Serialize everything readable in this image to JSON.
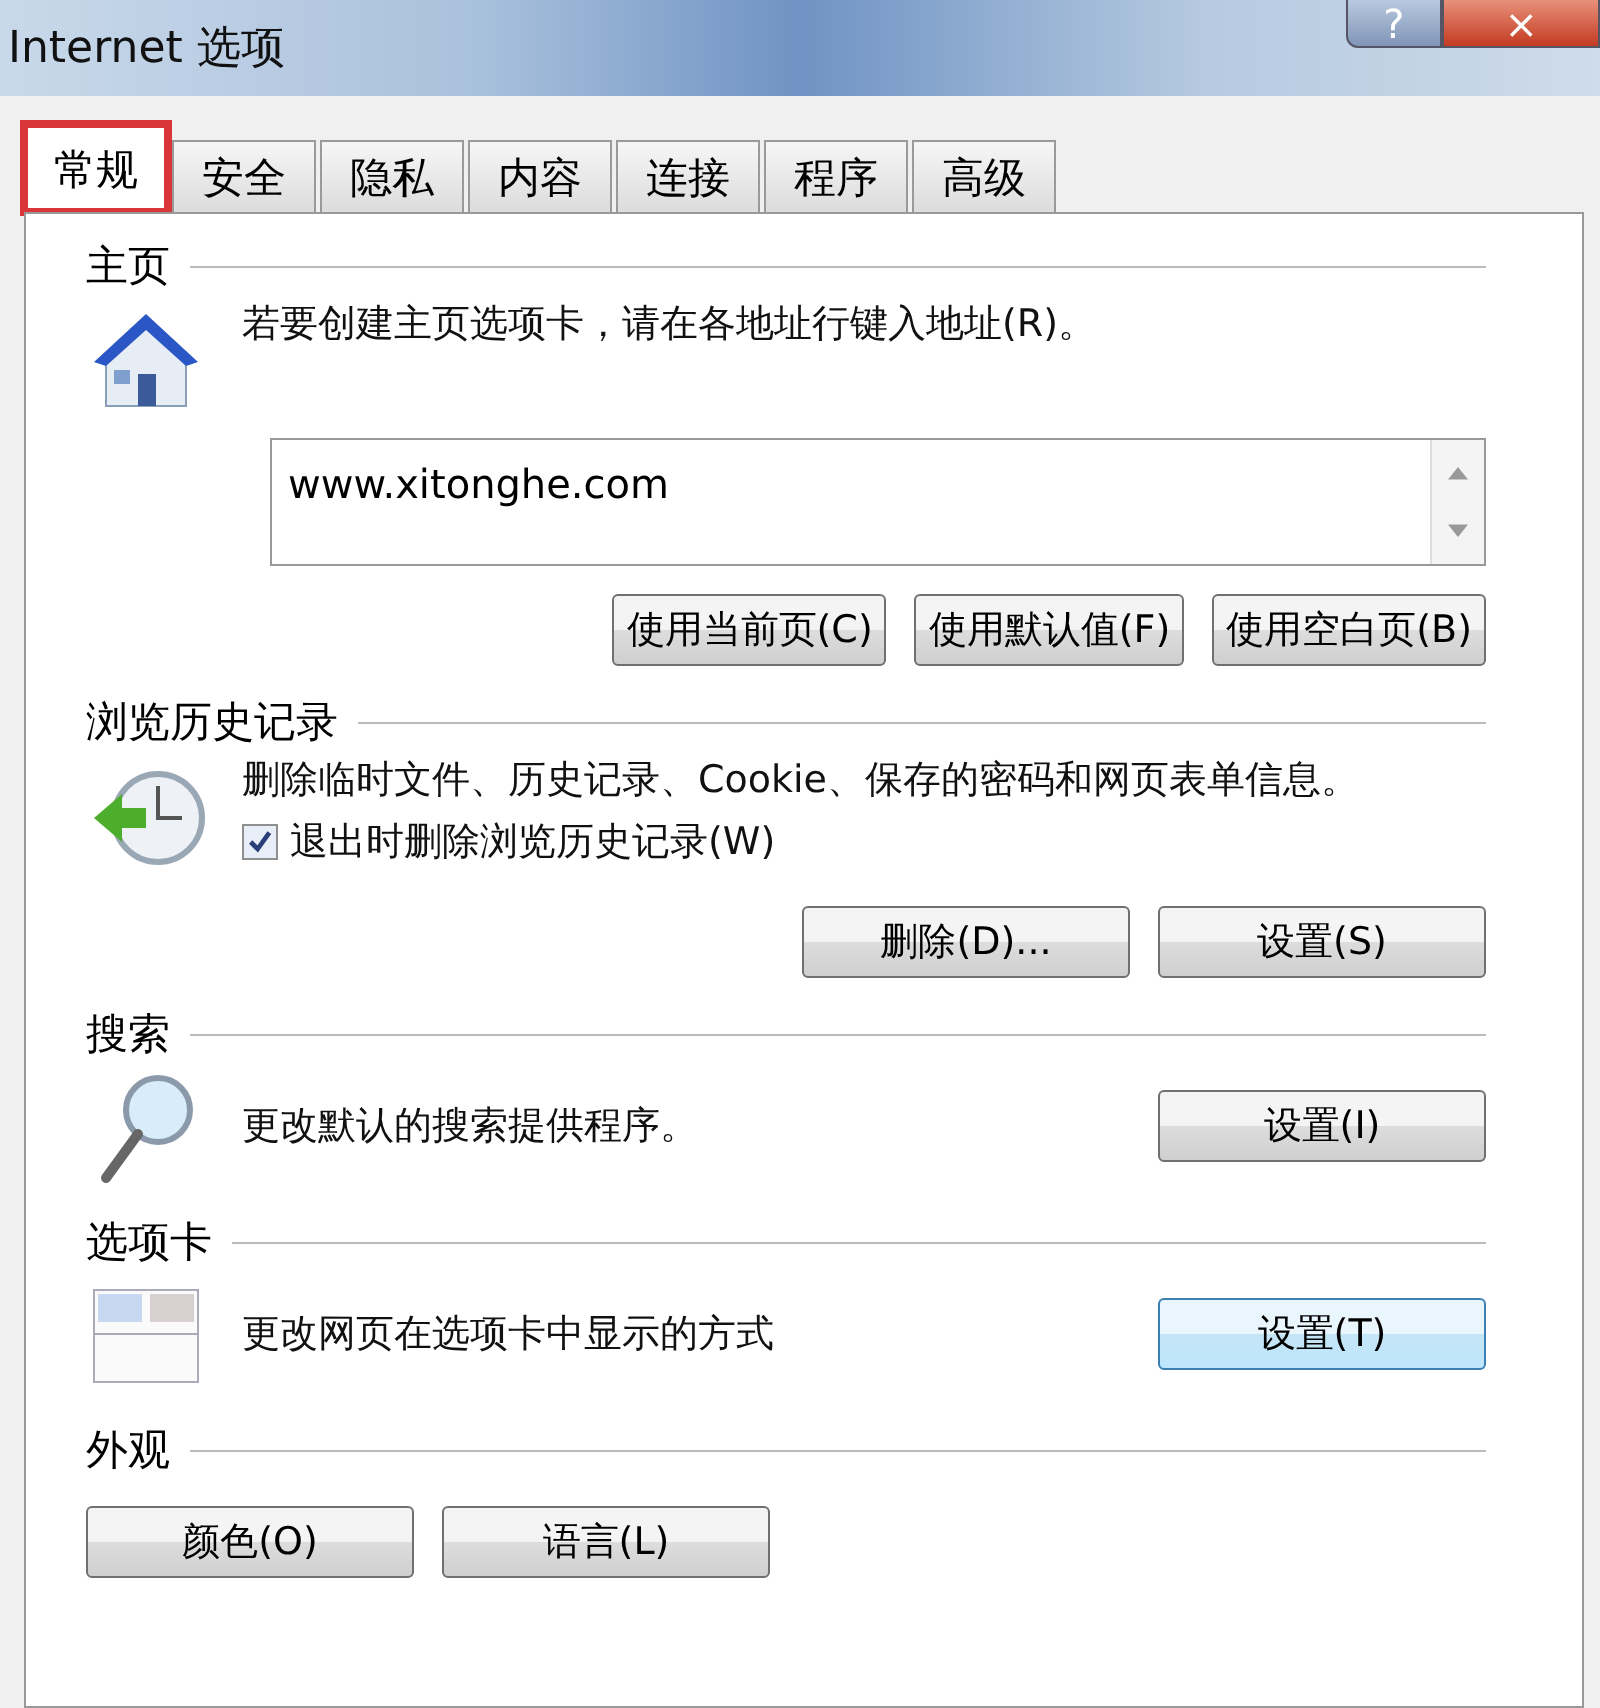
{
  "window": {
    "title": "Internet 选项",
    "help": "?",
    "close": "×"
  },
  "tabs": [
    {
      "label": "常规",
      "selected": true,
      "highlighted": true
    },
    {
      "label": "安全",
      "selected": false,
      "highlighted": false
    },
    {
      "label": "隐私",
      "selected": false,
      "highlighted": false
    },
    {
      "label": "内容",
      "selected": false,
      "highlighted": false
    },
    {
      "label": "连接",
      "selected": false,
      "highlighted": false
    },
    {
      "label": "程序",
      "selected": false,
      "highlighted": false
    },
    {
      "label": "高级",
      "selected": false,
      "highlighted": false
    }
  ],
  "home": {
    "heading": "主页",
    "text": "若要创建主页选项卡，请在各地址行键入地址(R)。",
    "value": "www.xitonghe.com",
    "buttons": [
      "使用当前页(C)",
      "使用默认值(F)",
      "使用空白页(B)"
    ]
  },
  "history": {
    "heading": "浏览历史记录",
    "text": "删除临时文件、历史记录、Cookie、保存的密码和网页表单信息。",
    "checkbox": {
      "label": "退出时删除浏览历史记录(W)",
      "checked": true
    },
    "buttons": [
      "删除(D)...",
      "设置(S)"
    ]
  },
  "search": {
    "heading": "搜索",
    "text": "更改默认的搜索提供程序。",
    "button": "设置(I)"
  },
  "tabs_section": {
    "heading": "选项卡",
    "text": "更改网页在选项卡中显示的方式",
    "button": "设置(T)"
  },
  "appearance": {
    "heading": "外观",
    "buttons": [
      "颜色(O)",
      "语言(L)"
    ]
  }
}
